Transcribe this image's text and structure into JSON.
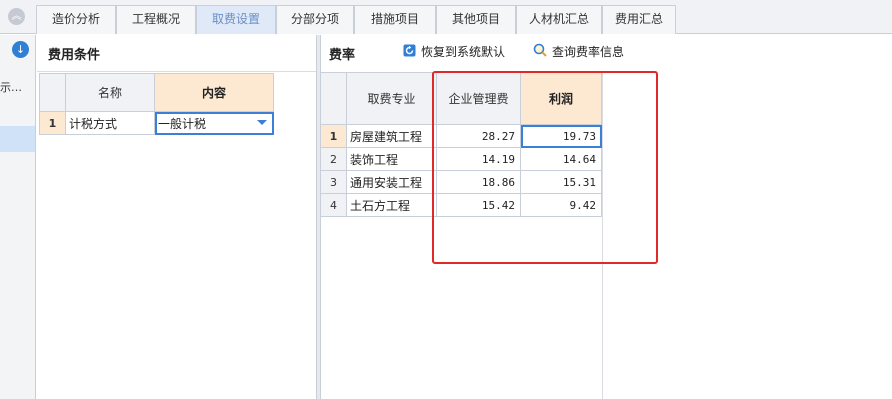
{
  "tabs": [
    {
      "label": "造价分析"
    },
    {
      "label": "工程概况"
    },
    {
      "label": "取费设置",
      "active": true
    },
    {
      "label": "分部分项"
    },
    {
      "label": "措施项目"
    },
    {
      "label": "其他项目"
    },
    {
      "label": "人材机汇总"
    },
    {
      "label": "费用汇总"
    }
  ],
  "left_strip": {
    "partial_text": "示…"
  },
  "fee_conditions": {
    "title": "费用条件",
    "headers": {
      "name": "名称",
      "content": "内容"
    },
    "rows": [
      {
        "num": "1",
        "name": "计税方式",
        "content": "一般计税"
      }
    ]
  },
  "fee_rates": {
    "title": "费率",
    "restore_label": "恢复到系统默认",
    "query_label": "查询费率信息",
    "headers": {
      "specialty": "取费专业",
      "mgmt": "企业管理费",
      "profit": "利润"
    },
    "rows": [
      {
        "num": "1",
        "specialty": "房屋建筑工程",
        "mgmt": "28.27",
        "profit": "19.73"
      },
      {
        "num": "2",
        "specialty": "装饰工程",
        "mgmt": "14.19",
        "profit": "14.64"
      },
      {
        "num": "3",
        "specialty": "通用安装工程",
        "mgmt": "18.86",
        "profit": "15.31"
      },
      {
        "num": "4",
        "specialty": "土石方工程",
        "mgmt": "15.42",
        "profit": "9.42"
      }
    ]
  },
  "colors": {
    "accent": "#3c7fd6",
    "header_highlight": "#fde9d2",
    "annotation_red": "#e02a2a"
  }
}
